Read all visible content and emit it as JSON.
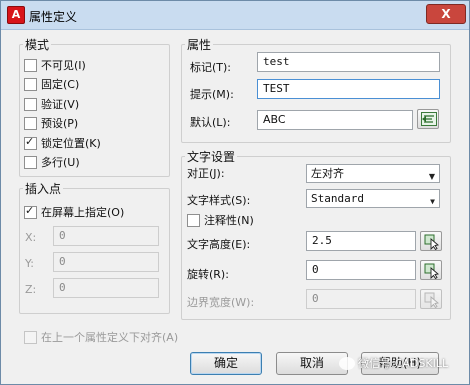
{
  "window": {
    "title": "属性定义",
    "close_label": "X"
  },
  "mode": {
    "title": "模式",
    "items": [
      {
        "label": "不可见(I)",
        "checked": false
      },
      {
        "label": "固定(C)",
        "checked": false
      },
      {
        "label": "验证(V)",
        "checked": false
      },
      {
        "label": "预设(P)",
        "checked": false
      },
      {
        "label": "锁定位置(K)",
        "checked": true
      },
      {
        "label": "多行(U)",
        "checked": false
      }
    ]
  },
  "attribute": {
    "title": "属性",
    "tag_label": "标记(T):",
    "tag_value": "test",
    "prompt_label": "提示(M):",
    "prompt_value": "TEST",
    "default_label": "默认(L):",
    "default_value": "ABC"
  },
  "insertion": {
    "title": "插入点",
    "on_screen_label": "在屏幕上指定(O)",
    "on_screen_checked": true,
    "x_label": "X:",
    "x_value": "0",
    "y_label": "Y:",
    "y_value": "0",
    "z_label": "Z:",
    "z_value": "0"
  },
  "text": {
    "title": "文字设置",
    "justify_label": "对正(J):",
    "justify_value": "左对齐",
    "style_label": "文字样式(S):",
    "style_value": "Standard",
    "annotative_label": "注释性(N)",
    "height_label": "文字高度(E):",
    "height_value": "2.5",
    "rotation_label": "旋转(R):",
    "rotation_value": "0",
    "boundary_label": "边界宽度(W):",
    "boundary_value": "0"
  },
  "align_below_label": "在上一个属性定义下对齐(A)",
  "buttons": {
    "ok": "确定",
    "cancel": "取消",
    "help": "帮助(H)"
  },
  "watermark": "微信号:CADSKILL",
  "colors": {
    "accent": "#3c7fb1",
    "title_bar": "#c9dcf0",
    "close": "#c9463d",
    "app_icon": "#d8141a"
  },
  "icons": [
    "autocad-a-icon",
    "insert-field-icon",
    "pick-point-icon"
  ]
}
